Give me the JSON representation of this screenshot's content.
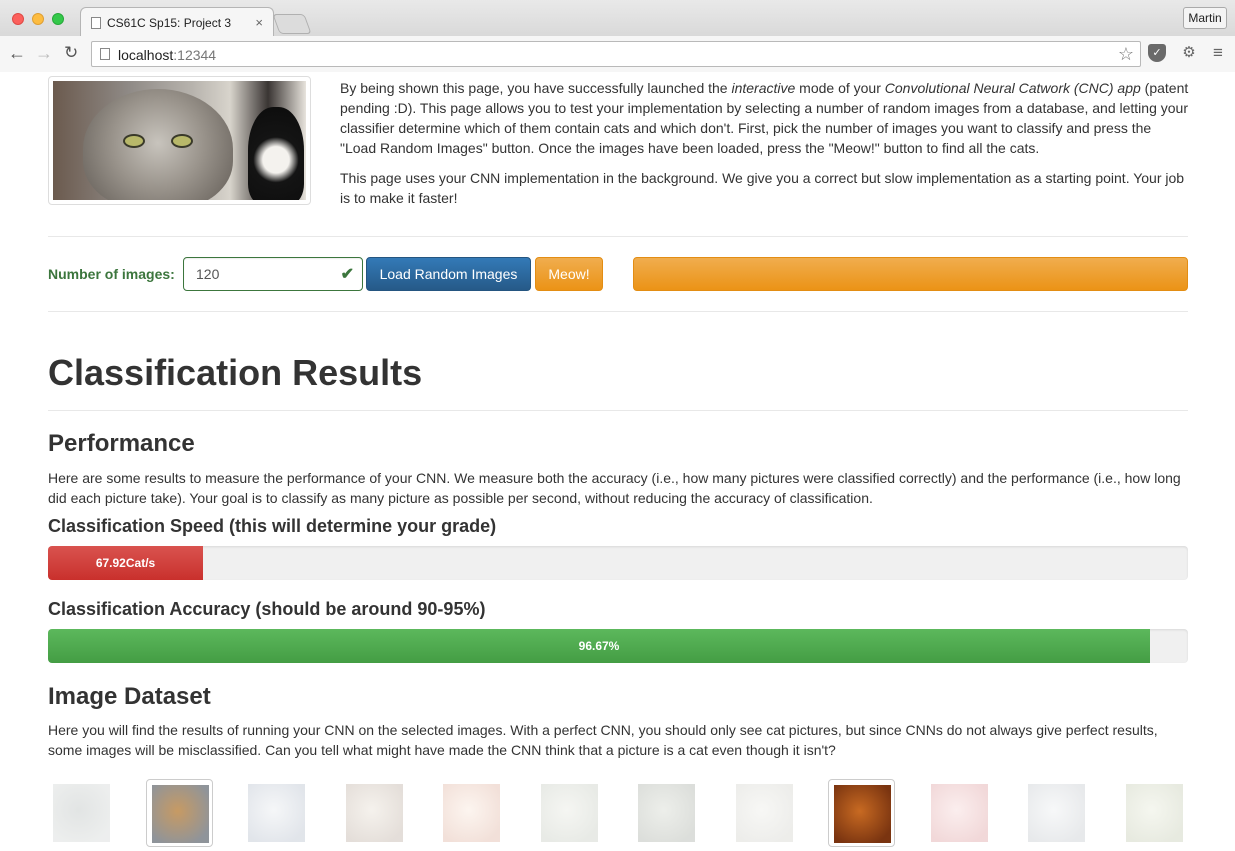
{
  "browser": {
    "tab_title": "CS61C Sp15: Project 3",
    "tab_close": "×",
    "profile": "Martin",
    "url_host": "localhost",
    "url_port": ":12344",
    "back": "←",
    "forward": "→",
    "reload": "↻",
    "star": "☆",
    "menu": "≡"
  },
  "intro": {
    "p1_a": "By being shown this page, you have successfully launched the ",
    "p1_em1": "interactive",
    "p1_b": " mode of your ",
    "p1_em2": "Convolutional Neural Catwork (CNC) app",
    "p1_c": " (patent pending :D). This page allows you to test your implementation by selecting a number of random images from a database, and letting your classifier determine which of them contain cats and which don't. First, pick the number of images you want to classify and press the \"Load Random Images\" button. Once the images have been loaded, press the \"Meow!\" button to find all the cats.",
    "p2": "This page uses your CNN implementation in the background. We give you a correct but slow implementation as a starting point. Your job is to make it faster!"
  },
  "controls": {
    "label": "Number of images:",
    "value": "120",
    "load_button": "Load Random Images",
    "meow_button": "Meow!",
    "check": "✔"
  },
  "results": {
    "title": "Classification Results",
    "performance_heading": "Performance",
    "performance_text": "Here are some results to measure the performance of your CNN. We measure both the accuracy (i.e., how many pictures were classified correctly) and the performance (i.e., how long did each picture take). Your goal is to classify as many picture as possible per second, without reducing the accuracy of classification.",
    "speed_heading": "Classification Speed (this will determine your grade)",
    "speed_label": "67.92Cat/s",
    "speed_fraction": 0.136,
    "accuracy_heading": "Classification Accuracy (should be around 90-95%)",
    "accuracy_label": "96.67%",
    "accuracy_fraction": 0.9667,
    "dataset_heading": "Image Dataset",
    "dataset_text": "Here you will find the results of running your CNN on the selected images. With a perfect CNN, you should only see cat pictures, but since CNNs do not always give perfect results, some images will be misclassified. Can you tell what might have made the CNN think that a picture is a cat even though it isn't?"
  },
  "colors": {
    "success": "#3c763d",
    "primary": "#337ab7",
    "warning": "#f0ad4e",
    "danger": "#d9534f",
    "progress_green": "#5cb85c"
  },
  "gallery": [
    {
      "name": "thumb-1",
      "classified_cat": false,
      "palette": [
        "#9aa3a0",
        "#5d6b68"
      ]
    },
    {
      "name": "thumb-2-cat",
      "classified_cat": true,
      "palette": [
        "#8f949a",
        "#c79a63"
      ]
    },
    {
      "name": "thumb-3",
      "classified_cat": false,
      "palette": [
        "#5a6e8c",
        "#c9d0d8"
      ]
    },
    {
      "name": "thumb-4",
      "classified_cat": false,
      "palette": [
        "#6b4a2e",
        "#c8b59a"
      ]
    },
    {
      "name": "thumb-5",
      "classified_cat": false,
      "palette": [
        "#b7542c",
        "#f0c7a8"
      ]
    },
    {
      "name": "thumb-6",
      "classified_cat": false,
      "palette": [
        "#7d8a72",
        "#c8ccb8"
      ]
    },
    {
      "name": "thumb-7",
      "classified_cat": false,
      "palette": [
        "#3e4a36",
        "#9aa38c"
      ]
    },
    {
      "name": "thumb-8",
      "classified_cat": false,
      "palette": [
        "#9a9a8c",
        "#d4d4c8"
      ]
    },
    {
      "name": "thumb-9-cat",
      "classified_cat": true,
      "palette": [
        "#7a3410",
        "#c86a22"
      ]
    },
    {
      "name": "thumb-10",
      "classified_cat": false,
      "palette": [
        "#b3262a",
        "#e8a0a0"
      ]
    },
    {
      "name": "thumb-11",
      "classified_cat": false,
      "palette": [
        "#7b8590",
        "#d2d8dc"
      ]
    },
    {
      "name": "thumb-12",
      "classified_cat": false,
      "palette": [
        "#7a8a52",
        "#c8d0a8"
      ]
    }
  ]
}
